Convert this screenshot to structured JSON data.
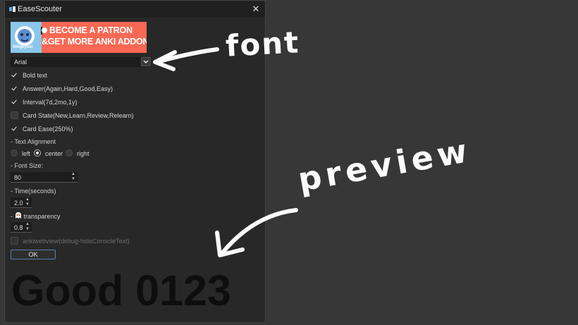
{
  "window": {
    "title": "EaseScouter",
    "close_glyph": "✕"
  },
  "banner": {
    "line1": "BECOME A PATRON",
    "line2": "&GET MORE ANKI ADDONS!",
    "mascot_name": "Shigeyuki",
    "color": "#f96854"
  },
  "font_select": {
    "value": "Arial",
    "icon": "chevron-down-icon"
  },
  "options": [
    {
      "label": "Bold text",
      "checked": true
    },
    {
      "label": "Answer(Again,Hard,Good,Easy)",
      "checked": true
    },
    {
      "label": "Interval(7d,2mo,1y)",
      "checked": true
    },
    {
      "label": "Card State(New,Learn,Review,Relearn)",
      "checked": false
    },
    {
      "label": "Card Ease(250%)",
      "checked": true
    }
  ],
  "text_alignment": {
    "label": "- Text Alignment",
    "options": [
      "left",
      "center",
      "right"
    ],
    "selected": "center"
  },
  "font_size": {
    "label": "- Font Size:",
    "value": "80"
  },
  "time": {
    "label": "- Time(seconds)",
    "value": "2.0"
  },
  "transparency": {
    "label_prefix": "- ",
    "label": "transparency",
    "value": "0.8"
  },
  "webview_option": {
    "label": "ankiwebview(debug-hideConsoleText)",
    "checked": false,
    "enabled": false
  },
  "ok_label": "OK",
  "preview_text": "Good 0123",
  "annotations": {
    "font": "font",
    "preview": "preview"
  }
}
